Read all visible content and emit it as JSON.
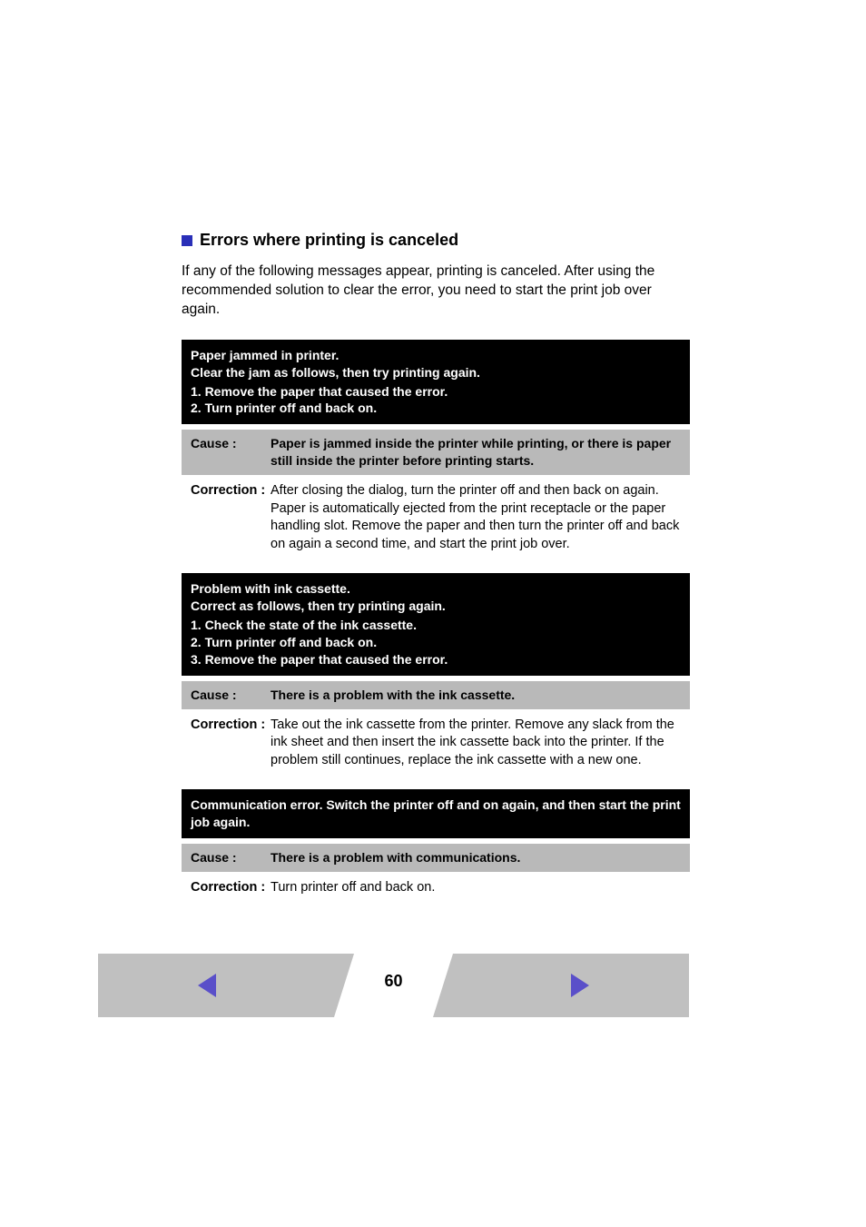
{
  "section": {
    "title": "Errors where printing is canceled",
    "intro": "If any of the following messages appear, printing is canceled. After using the recommended solution to clear the error, you need to start the print job over again."
  },
  "blocks": [
    {
      "header_line1": "Paper jammed in printer.",
      "header_line2": "Clear the jam as follows, then try printing again.",
      "steps": [
        "1.  Remove the paper that caused the error.",
        "2.  Turn printer off and back on."
      ],
      "cause_label": "Cause :",
      "cause_text": "Paper is jammed inside the printer while printing, or there is paper still inside the printer before printing starts.",
      "correction_label": "Correction :",
      "correction_text": "After closing the dialog, turn the printer off and then back on again. Paper is automatically ejected from the print receptacle or the paper handling slot. Remove the paper and then turn the printer off and back on again a second time, and start the print job over."
    },
    {
      "header_line1": "Problem with ink cassette.",
      "header_line2": "Correct as follows, then try printing again.",
      "steps": [
        "1.  Check the state of the ink cassette.",
        "2.  Turn printer off and back on.",
        "3.  Remove the paper that caused the error."
      ],
      "cause_label": "Cause :",
      "cause_text": "There is a problem with the ink cassette.",
      "correction_label": "Correction :",
      "correction_text": "Take out the ink cassette from the printer. Remove any slack from the ink sheet and then insert the ink cassette back into the printer. If the problem still continues, replace the ink cassette with a new one."
    },
    {
      "header_line1": "Communication error. Switch the printer off and on again, and then start the print job again.",
      "header_line2": "",
      "steps": [],
      "cause_label": "Cause :",
      "cause_text": "There is a problem with communications.",
      "correction_label": "Correction :",
      "correction_text": "Turn printer off and back on."
    }
  ],
  "footer": {
    "page_number": "60",
    "nav_color": "#5a4fc9"
  }
}
